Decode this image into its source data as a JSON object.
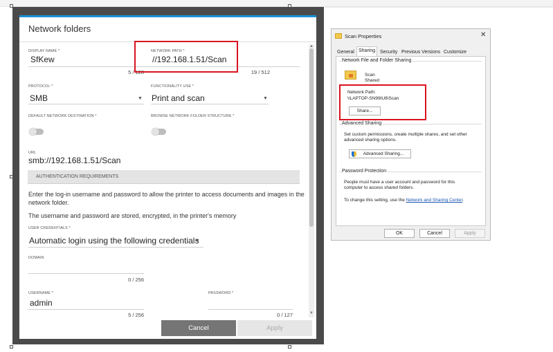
{
  "dialog": {
    "title": "Network folders",
    "fields": {
      "display_name": {
        "label": "DISPLAY NAME *",
        "value": "SfKew",
        "count": "5 / 128"
      },
      "network_path": {
        "label": "NETWORK PATH *",
        "value": "//192.168.1.51/Scan",
        "count": "19 / 512"
      },
      "protocol": {
        "label": "PROTOCOL *",
        "value": "SMB"
      },
      "functionality_use": {
        "label": "FUNCTIONALITY USE *",
        "value": "Print and scan"
      },
      "default_destination": {
        "label": "DEFAULT NETWORK DESTINATION *"
      },
      "browse_structure": {
        "label": "BROWSE NETWORK FOLDER STRUCTURE *"
      },
      "url": {
        "label": "URL",
        "value": "smb://192.168.1.51/Scan"
      },
      "user_credentials": {
        "label": "USER CREDENTIALS *",
        "value": "Automatic login using the following credentials"
      },
      "domain": {
        "label": "DOMAIN",
        "value": "",
        "count": "0 / 256"
      },
      "username": {
        "label": "USERNAME *",
        "value": "admin",
        "count": "5 / 256"
      },
      "password": {
        "label": "PASSWORD *",
        "value": "",
        "count": "0 / 127"
      }
    },
    "auth_section": "AUTHENTICATION REQUIREMENTS",
    "auth_text_1": "Enter the log-in username and password to allow the printer to access documents and images in the network folder.",
    "auth_text_2": "The username and password are stored, encrypted, in the printer's memory",
    "buttons": {
      "cancel": "Cancel",
      "apply": "Apply"
    },
    "accent_color": "#1a8fd6",
    "highlight_color": "#d8121e"
  },
  "properties": {
    "title": "Scan Properties",
    "close": "✕",
    "tabs": [
      "General",
      "Sharing",
      "Security",
      "Previous Versions",
      "Customize"
    ],
    "active_tab": "Sharing",
    "file_sharing": {
      "group_title": "Network File and Folder Sharing",
      "folder_name": "Scan",
      "folder_status": "Shared",
      "network_path_label": "Network Path:",
      "network_path_value": "\\\\LAPTOP-SN99IU8\\Scan",
      "share_button": "Share..."
    },
    "advanced": {
      "group_title": "Advanced Sharing",
      "text_1": "Set custom permissions, create multiple shares, and set other",
      "text_2": "advanced sharing options.",
      "button": "Advanced Sharing..."
    },
    "password": {
      "group_title": "Password Protection",
      "text_1": "People must have a user account and password for this",
      "text_2": "computer to access shared folders.",
      "text_3": "To change this setting, use the",
      "link": "Network and Sharing Center",
      "text_end": "."
    },
    "buttons": {
      "ok": "OK",
      "cancel": "Cancel",
      "apply": "Apply"
    }
  }
}
